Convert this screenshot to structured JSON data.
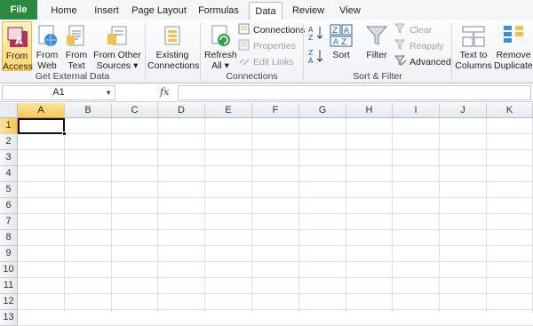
{
  "tabs": [
    {
      "label": "File"
    },
    {
      "label": "Home"
    },
    {
      "label": "Insert"
    },
    {
      "label": "Page Layout"
    },
    {
      "label": "Formulas"
    },
    {
      "label": "Data"
    },
    {
      "label": "Review"
    },
    {
      "label": "View"
    }
  ],
  "get_external": {
    "group_label": "Get External Data",
    "from_access": {
      "line1": "From",
      "line2": "Access",
      "icon": "access-database-icon"
    },
    "from_web": {
      "line1": "From",
      "line2": "Web",
      "icon": "web-globe-icon"
    },
    "from_text": {
      "line1": "From",
      "line2": "Text",
      "icon": "text-file-icon"
    },
    "from_other": {
      "line1": "From Other",
      "line2": "Sources ▾",
      "icon": "other-sources-icon"
    }
  },
  "existing": {
    "line1": "Existing",
    "line2": "Connections"
  },
  "connections": {
    "group_label": "Connections",
    "refresh": {
      "line1": "Refresh",
      "line2": "All ▾"
    },
    "connections": "Connections",
    "properties": "Properties",
    "edit_links": "Edit Links"
  },
  "sort_filter": {
    "group_label": "Sort & Filter",
    "sort": "Sort",
    "filter": "Filter",
    "clear": "Clear",
    "reapply": "Reapply",
    "advanced": "Advanced"
  },
  "data_tools": {
    "text_to_columns": {
      "line1": "Text to",
      "line2": "Columns"
    },
    "remove_duplicates": {
      "line1": "Remove",
      "line2": "Duplicates"
    }
  },
  "formula_bar": {
    "name_box": "A1",
    "fx": "fx",
    "formula": ""
  },
  "columns": [
    "A",
    "B",
    "C",
    "D",
    "E",
    "F",
    "G",
    "H",
    "I",
    "J",
    "K"
  ],
  "rows": [
    "1",
    "2",
    "3",
    "4",
    "5",
    "6",
    "7",
    "8",
    "9",
    "10",
    "11",
    "12",
    "13"
  ],
  "selected_cell": "A1"
}
